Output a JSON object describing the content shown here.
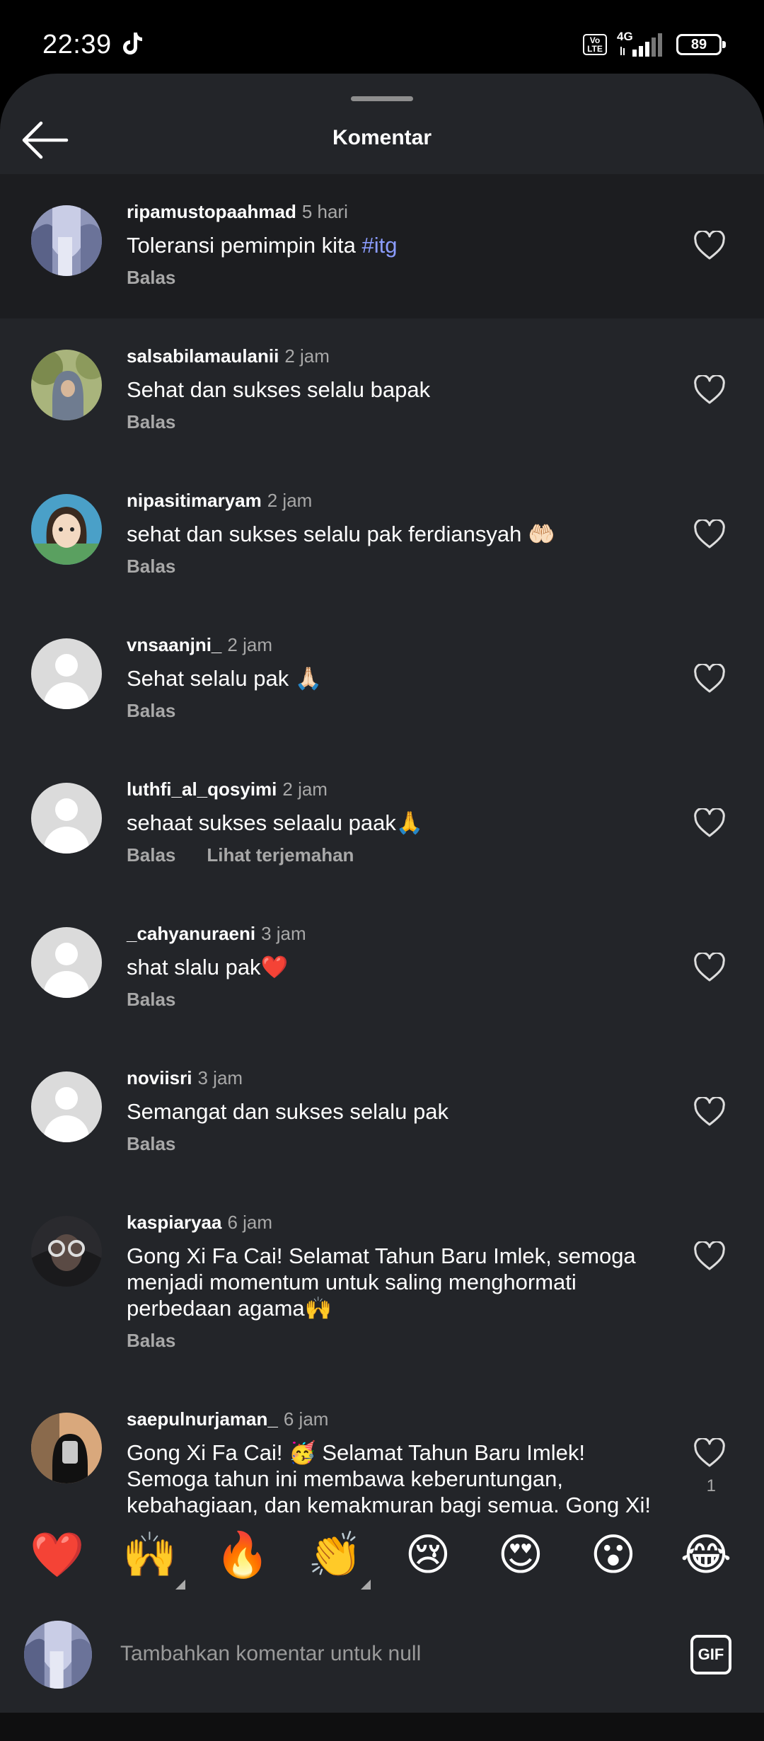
{
  "status_bar": {
    "time": "22:39",
    "volte_top": "Vo",
    "volte_bottom": "LTE",
    "network": "4G",
    "battery": "89"
  },
  "header": {
    "title": "Komentar",
    "back_icon": "arrow-left-icon"
  },
  "comments": [
    {
      "user": "ripamustopaahmad",
      "time": "5 hari",
      "text": "Toleransi pemimpin kita ",
      "hashtag": "#itg",
      "reply": "Balas",
      "highlight": true
    },
    {
      "user": "salsabilamaulanii",
      "time": "2 jam",
      "text": "Sehat dan sukses selalu bapak",
      "reply": "Balas"
    },
    {
      "user": "nipasitimaryam",
      "time": "2 jam",
      "text": "sehat dan sukses selalu pak ferdiansyah 🤲🏻",
      "reply": "Balas"
    },
    {
      "user": "vnsaanjni_",
      "time": "2 jam",
      "text": "Sehat selalu pak 🙏🏻",
      "reply": "Balas"
    },
    {
      "user": "luthfi_al_qosyimi",
      "time": "2 jam",
      "text": "sehaat sukses selaalu paak🙏",
      "reply": "Balas",
      "translate": "Lihat terjemahan"
    },
    {
      "user": "_cahyanuraeni",
      "time": "3 jam",
      "text": "shat slalu pak❤️",
      "reply": "Balas"
    },
    {
      "user": "noviisri",
      "time": "3 jam",
      "text": "Semangat dan sukses selalu pak",
      "reply": "Balas"
    },
    {
      "user": "kaspiaryaa",
      "time": "6 jam",
      "text": "Gong Xi Fa Cai! Selamat Tahun Baru Imlek, semoga menjadi momentum untuk saling menghormati perbedaan agama🙌",
      "reply": "Balas"
    },
    {
      "user": "saepulnurjaman_",
      "time": "6 jam",
      "text": "Gong Xi Fa Cai! 🥳 Selamat Tahun Baru Imlek! Semoga tahun ini membawa keberuntungan, kebahagiaan, dan kemakmuran bagi semua. Gong Xi! 🎊🧧",
      "like_count": "1"
    }
  ],
  "quick_reactions": [
    "❤️",
    "🙌",
    "🔥",
    "👏",
    "😢",
    "😍",
    "😮",
    "😂"
  ],
  "composer": {
    "placeholder": "Tambahkan komentar untuk null",
    "gif_label": "GIF"
  },
  "colors": {
    "background": "#232529",
    "highlight_row": "#1c1d20",
    "muted_text": "#a8a8a8",
    "hashtag": "#8b9cff"
  }
}
